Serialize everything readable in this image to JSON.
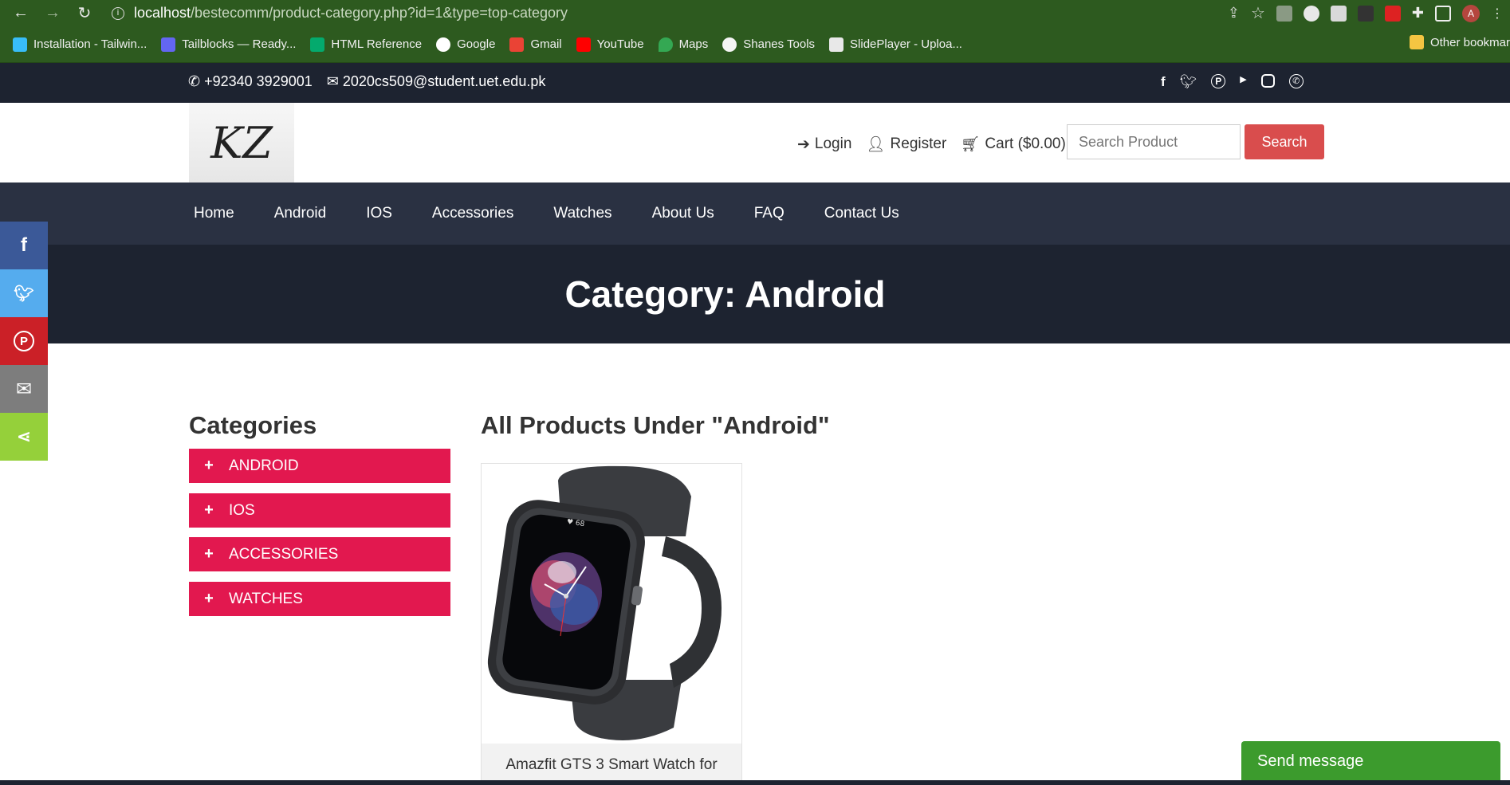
{
  "browser": {
    "url_host": "localhost",
    "url_path": "/bestecomm/product-category.php?id=1&type=top-category",
    "bookmarks": [
      "Installation - Tailwin...",
      "Tailblocks — Ready...",
      "HTML Reference",
      "Google",
      "Gmail",
      "YouTube",
      "Maps",
      "Shanes Tools",
      "SlidePlayer - Uploa..."
    ],
    "other_bookmarks": "Other bookmar"
  },
  "topbar": {
    "phone": "+92340 3929001",
    "email": "2020cs509@student.uet.edu.pk"
  },
  "header": {
    "logo_text": "KZ",
    "login": "Login",
    "register": "Register",
    "cart": "Cart ($0.00)",
    "search_placeholder": "Search Product",
    "search_button": "Search"
  },
  "nav": [
    "Home",
    "Android",
    "IOS",
    "Accessories",
    "Watches",
    "About Us",
    "FAQ",
    "Contact Us"
  ],
  "hero": {
    "title": "Category: Android"
  },
  "share": [
    {
      "name": "facebook",
      "color": "#3b5998",
      "glyph": "f"
    },
    {
      "name": "twitter",
      "color": "#55acee",
      "glyph": "t"
    },
    {
      "name": "pinterest",
      "color": "#cb2027",
      "glyph": "P"
    },
    {
      "name": "email",
      "color": "#7d7d7d",
      "glyph": "✉"
    },
    {
      "name": "share",
      "color": "#95d03a",
      "glyph": "<"
    }
  ],
  "sidebar": {
    "title": "Categories",
    "items": [
      "ANDROID",
      "IOS",
      "ACCESSORIES",
      "WATCHES"
    ]
  },
  "products": {
    "title": "All Products Under \"Android\"",
    "items": [
      {
        "name": "Amazfit GTS 3 Smart Watch for"
      }
    ]
  },
  "chat": {
    "label": "Send message"
  }
}
